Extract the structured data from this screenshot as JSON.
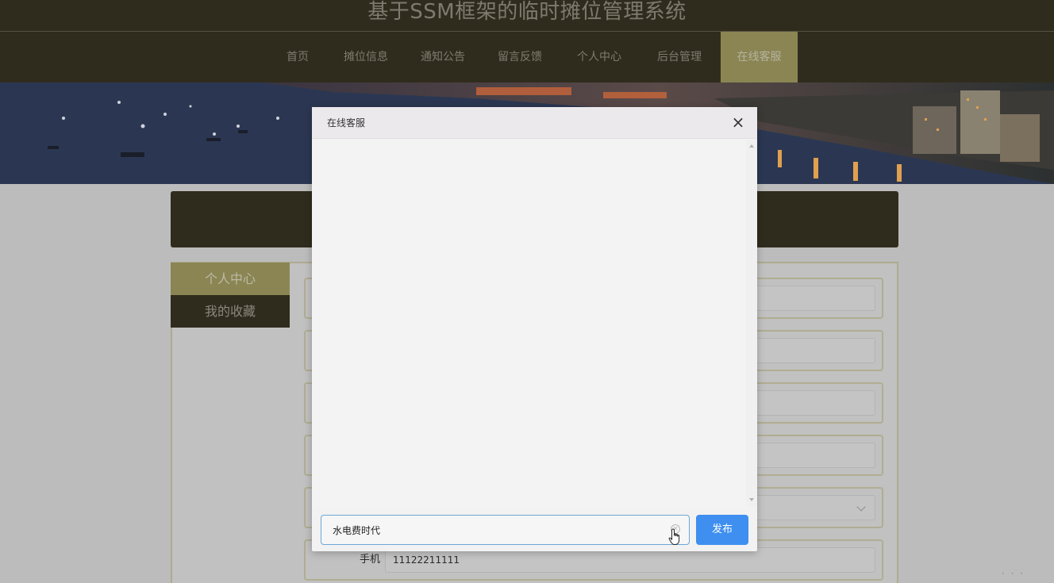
{
  "site": {
    "title": "基于SSM框架的临时摊位管理系统"
  },
  "nav": {
    "items": [
      {
        "label": "首页",
        "active": false
      },
      {
        "label": "摊位信息",
        "active": false
      },
      {
        "label": "通知公告",
        "active": false
      },
      {
        "label": "留言反馈",
        "active": false
      },
      {
        "label": "个人中心",
        "active": false
      },
      {
        "label": "后台管理",
        "active": false
      },
      {
        "label": "在线客服",
        "active": true
      }
    ]
  },
  "sidebar": {
    "items": [
      {
        "label": "个人中心",
        "active": true
      },
      {
        "label": "我的收藏",
        "active": false
      }
    ]
  },
  "form": {
    "phone_label": "手机",
    "phone_value": "11122211111"
  },
  "chat_dialog": {
    "title": "在线客服",
    "close_glyph": "×",
    "input_value": "水电费时代",
    "send_label": "发布"
  },
  "colors": {
    "header_bg": "#302c1d",
    "accent": "#8a8553",
    "send_button": "#3e8ff0"
  }
}
